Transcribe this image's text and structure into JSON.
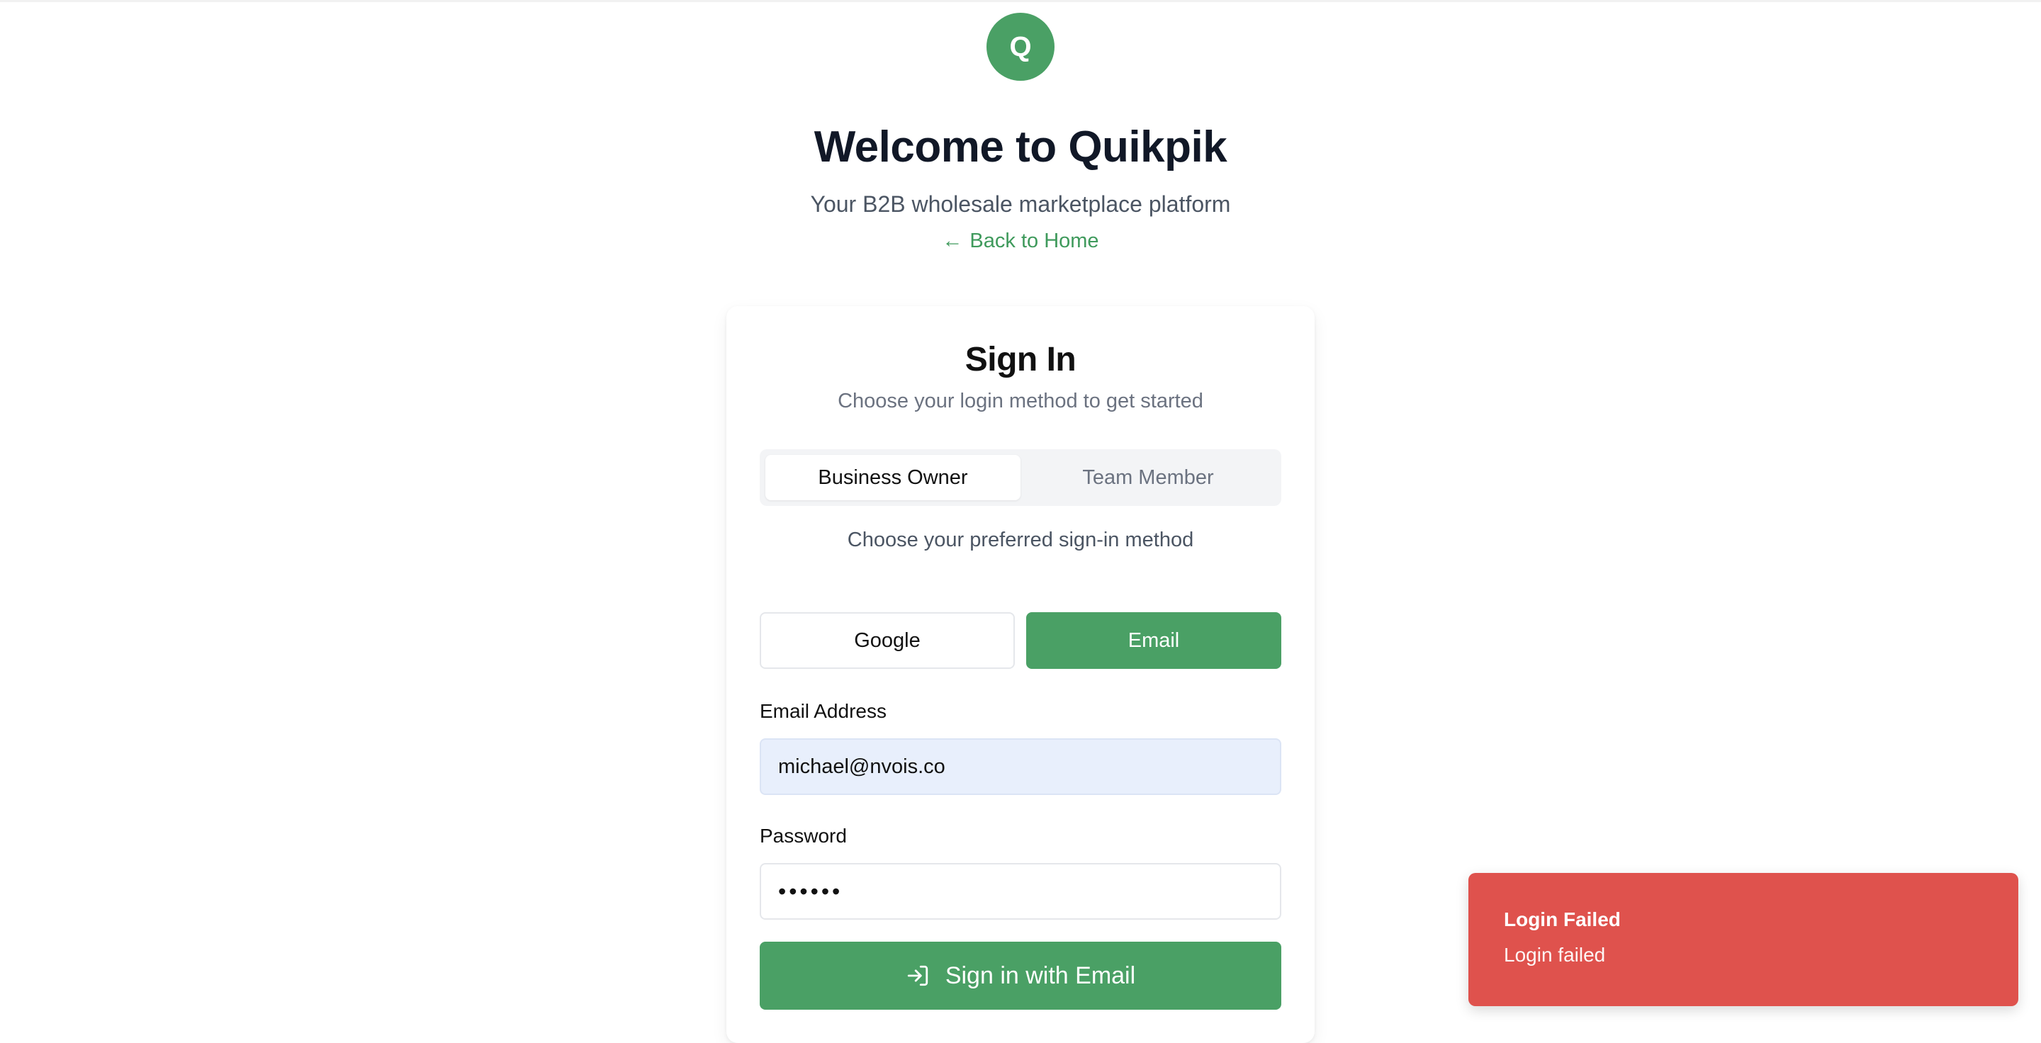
{
  "brand": {
    "logo_letter": "Q",
    "accent_color": "#4aa065",
    "error_color": "#df524d"
  },
  "header": {
    "title": "Welcome to Quikpik",
    "subtitle": "Your B2B wholesale marketplace platform",
    "back_arrow": "←",
    "back_label": "Back to Home"
  },
  "card": {
    "title": "Sign In",
    "subtitle": "Choose your login method to get started",
    "role_tabs": [
      {
        "label": "Business Owner",
        "active": true
      },
      {
        "label": "Team Member",
        "active": false
      }
    ],
    "method_hint": "Choose your preferred sign-in method",
    "methods": [
      {
        "label": "Google",
        "selected": false
      },
      {
        "label": "Email",
        "selected": true
      }
    ],
    "email": {
      "label": "Email Address",
      "value": "michael@nvois.co"
    },
    "password": {
      "label": "Password",
      "value": "••••••"
    },
    "submit": {
      "icon": "log-in-icon",
      "label": "Sign in with Email"
    }
  },
  "toast": {
    "title": "Login Failed",
    "description": "Login failed"
  }
}
